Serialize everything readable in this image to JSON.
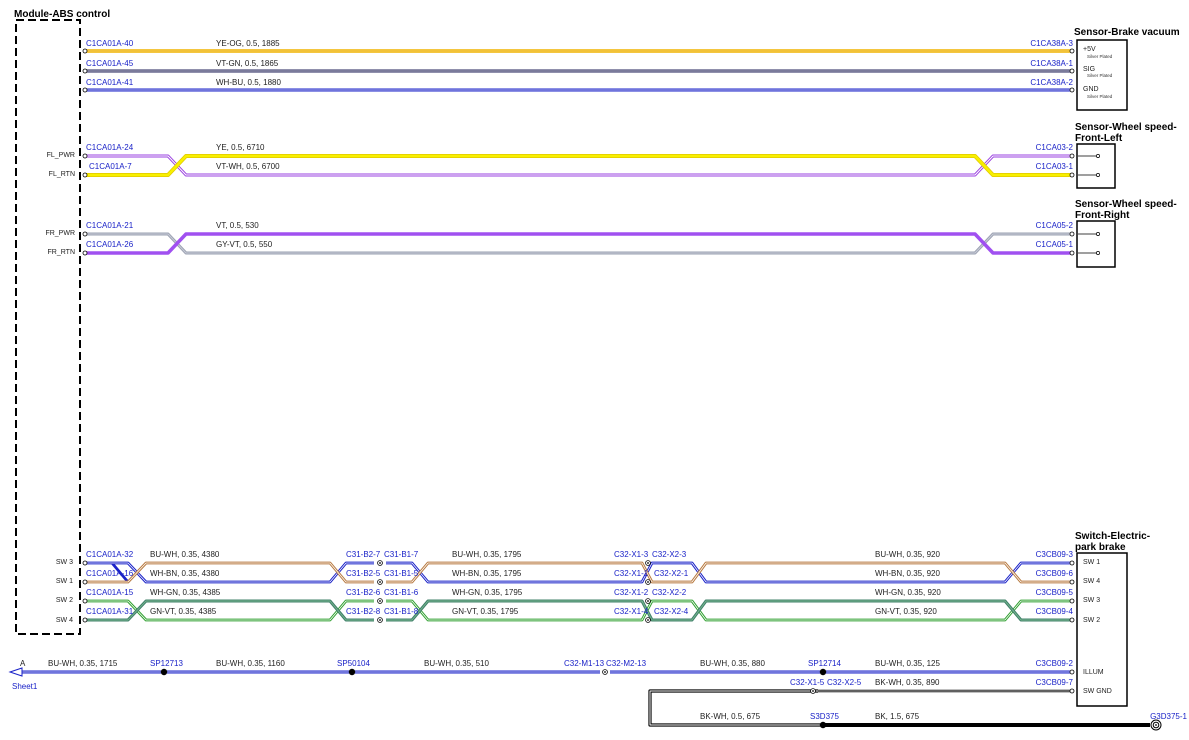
{
  "components": {
    "module_abs": "Module-ABS control",
    "brake_vacuum": "Sensor-Brake vacuum",
    "wheel_fl": [
      "Sensor-Wheel speed-",
      "Front-Left"
    ],
    "wheel_fr": [
      "Sensor-Wheel speed-",
      "Front-Right"
    ],
    "park_brake": [
      "Switch-Electric-",
      "park brake"
    ]
  },
  "brake_vacuum_pins": [
    {
      "name": "+5V",
      "note": "Silver Plated"
    },
    {
      "name": "SIG",
      "note": "Silver Plated"
    },
    {
      "name": "GND",
      "note": "Silver Plated"
    }
  ],
  "wheel_pins": {
    "fl_pwr": "FL_PWR",
    "fl_rtn": "FL_RTN",
    "fr_pwr": "FR_PWR",
    "fr_rtn": "FR_RTN"
  },
  "switch_pins_left": [
    "SW 3",
    "SW 1",
    "SW 2",
    "SW 4"
  ],
  "switch_pins_right": [
    "SW 1",
    "SW 4",
    "SW 3",
    "SW 2",
    "ILLUM",
    "SW GND"
  ],
  "vacuum_wires": [
    {
      "left": "C1CA01A-40",
      "label": "YE-OG,  0.5,  1885",
      "right": "C1CA38A-3",
      "color": "#f0b400",
      "stroke": "#f0b400"
    },
    {
      "left": "C1CA01A-45",
      "label": "VT-GN,  0.5,  1865",
      "right": "C1CA38A-1",
      "color": "#7a7a96",
      "stroke": "#6b6b90"
    },
    {
      "left": "C1CA01A-41",
      "label": "WH-BU,  0.5,  1880",
      "right": "C1CA38A-2",
      "color": "#1a22c8",
      "stroke": "#1a22c8"
    }
  ],
  "fl_wires": [
    {
      "left": "C1CA01A-24",
      "label": "YE,  0.5,  6710",
      "right": "C1CA03-2",
      "color": "#9a40e0"
    },
    {
      "left": "C1CA01A-7",
      "label": "VT-WH,  0.5,  6700",
      "right": "C1CA03-1",
      "color": "#f0e000"
    }
  ],
  "fr_wires": [
    {
      "left": "C1CA01A-21",
      "label": "VT,  0.5,  530",
      "right": "C1CA05-2",
      "color": "#9aa0b0"
    },
    {
      "left": "C1CA01A-26",
      "label": "GY-VT,  0.5,  550",
      "right": "C1CA05-1",
      "color": "#a050f0"
    }
  ],
  "switch_wires": [
    {
      "a": "C1CA01A-32",
      "s1": "BU-WH,  0.35,  4380",
      "b1": "C31-B2-7",
      "b2": "C31-B1-7",
      "s2": "BU-WH,  0.35,  1795",
      "c1": "C32-X1-3",
      "c2": "C32-X2-3",
      "s3": "BU-WH,  0.35,  920",
      "d": "C3CB09-3",
      "color": "#1a22c8"
    },
    {
      "a": "C1CA01A-16",
      "s1": "WH-BN,  0.35,  4380",
      "b1": "C31-B2-5",
      "b2": "C31-B1-5",
      "s2": "WH-BN,  0.35,  1795",
      "c1": "C32-X1-1",
      "c2": "C32-X2-1",
      "s3": "WH-BN,  0.35,  920",
      "d": "C3CB09-6",
      "color": "#b87a40"
    },
    {
      "a": "C1CA01A-15",
      "s1": "WH-GN,  0.35,  4385",
      "b1": "C31-B2-6",
      "b2": "C31-B1-6",
      "s2": "WH-GN,  0.35,  1795",
      "c1": "C32-X1-2",
      "c2": "C32-X2-2",
      "s3": "WH-GN,  0.35,  920",
      "d": "C3CB09-5",
      "color": "#30a030"
    },
    {
      "a": "C1CA01A-31",
      "s1": "GN-VT,  0.35,  4385",
      "b1": "C31-B2-8",
      "b2": "C31-B1-8",
      "s2": "GN-VT,  0.35,  1795",
      "c1": "C32-X1-4",
      "c2": "C32-X2-4",
      "s3": "GN-VT,  0.35,  920",
      "d": "C3CB09-4",
      "color": "#40806a"
    }
  ],
  "illum": {
    "sheet_letter": "A",
    "sheet_ref": "Sheet1",
    "seg1": "BU-WH,  0.35,  1715",
    "sp1": "SP12713",
    "seg2": "BU-WH,  0.35,  1160",
    "sp2": "SP50104",
    "seg3": "BU-WH,  0.35,  510",
    "conn1": "C32-M1-13",
    "conn2": "C32-M2-13",
    "seg4": "BU-WH,  0.35,  880",
    "sp3": "SP12714",
    "seg5": "BU-WH,  0.35,  125",
    "end": "C3CB09-2"
  },
  "swgnd": {
    "conn1": "C32-X1-5",
    "conn2": "C32-X2-5",
    "seg1": "BK-WH,  0.35,  890",
    "end": "C3CB09-7",
    "seg2": "BK-WH,  0.5,  675",
    "splice": "S3D375",
    "seg3": "BK,  1.5,  675",
    "ground": "G3D375-1"
  }
}
